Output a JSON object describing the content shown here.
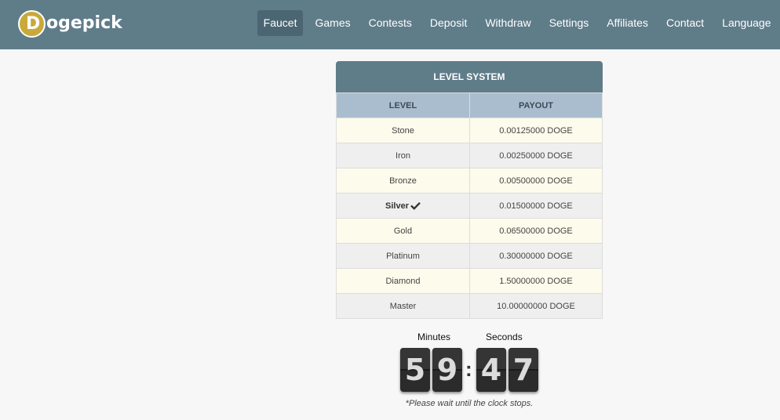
{
  "brand": {
    "logo_letter": "D",
    "name": "ogepick"
  },
  "nav": [
    {
      "label": "Faucet",
      "active": true
    },
    {
      "label": "Games"
    },
    {
      "label": "Contests"
    },
    {
      "label": "Deposit"
    },
    {
      "label": "Withdraw"
    },
    {
      "label": "Settings"
    },
    {
      "label": "Affiliates"
    },
    {
      "label": "Contact"
    },
    {
      "label": "Language"
    }
  ],
  "level_system": {
    "title": "LEVEL SYSTEM",
    "headers": {
      "level": "LEVEL",
      "payout": "PAYOUT"
    },
    "rows": [
      {
        "level": "Stone",
        "payout": "0.00125000 DOGE"
      },
      {
        "level": "Iron",
        "payout": "0.00250000 DOGE"
      },
      {
        "level": "Bronze",
        "payout": "0.00500000 DOGE"
      },
      {
        "level": "Silver",
        "payout": "0.01500000 DOGE",
        "current": true
      },
      {
        "level": "Gold",
        "payout": "0.06500000 DOGE"
      },
      {
        "level": "Platinum",
        "payout": "0.30000000 DOGE"
      },
      {
        "level": "Diamond",
        "payout": "1.50000000 DOGE"
      },
      {
        "level": "Master",
        "payout": "10.00000000 DOGE"
      }
    ]
  },
  "timer": {
    "minutes_label": "Minutes",
    "seconds_label": "Seconds",
    "digits": [
      "5",
      "9",
      "4",
      "7"
    ],
    "separator": ":",
    "note": "*Please wait until the clock stops."
  },
  "colors": {
    "navbar": "#5f7c89",
    "header_row": "#a9bdcf",
    "odd_row": "#fdfbeb",
    "even_row": "#efefef",
    "logo_coin": "#c9a93a"
  }
}
